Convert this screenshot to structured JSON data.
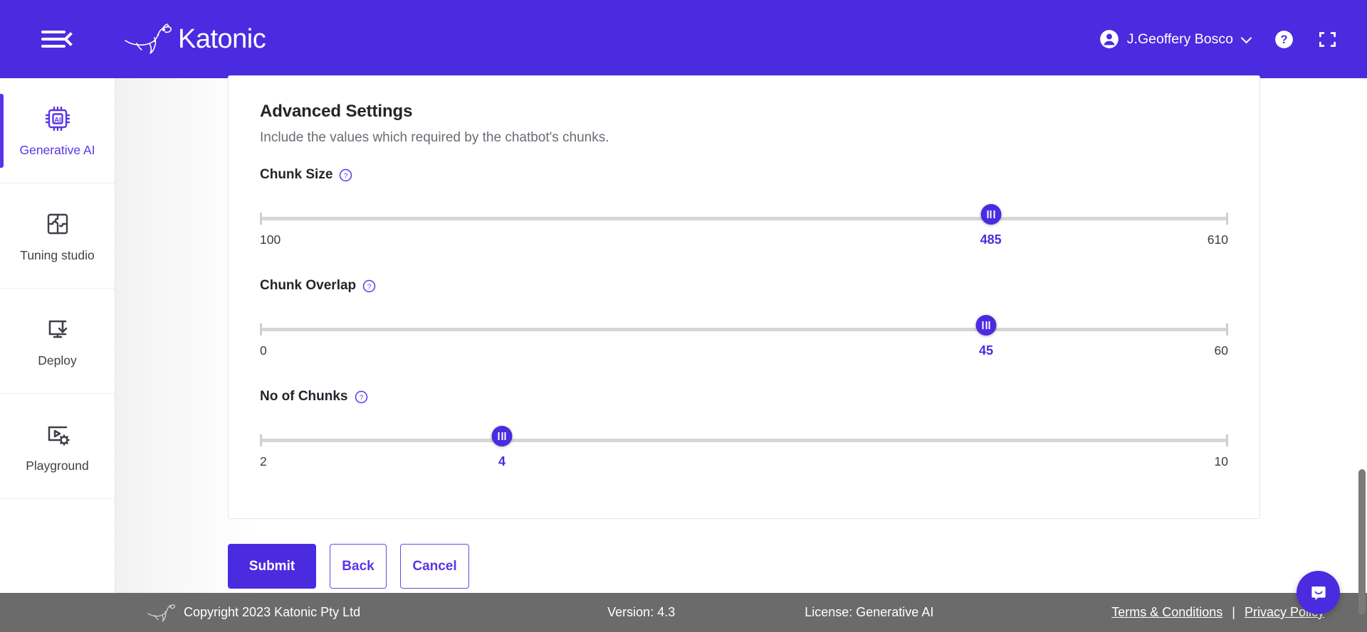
{
  "header": {
    "menu_toggle": "collapse-menu",
    "brand": "Katonic",
    "user_name": "J.Geoffery Bosco",
    "help_label": "?",
    "icons": {
      "avatar": "user-avatar-icon",
      "chevron": "chevron-down-icon",
      "help": "help-circle-icon",
      "fullscreen": "fullscreen-icon"
    },
    "colors": {
      "brand_purple": "#4B2BE0"
    }
  },
  "sidebar": {
    "items": [
      {
        "label": "Generative AI",
        "icon": "ai-chip-icon",
        "active": true
      },
      {
        "label": "Tuning studio",
        "icon": "puzzle-icon",
        "active": false
      },
      {
        "label": "Deploy",
        "icon": "monitor-download-icon",
        "active": false
      },
      {
        "label": "Playground",
        "icon": "video-gear-icon",
        "active": false
      }
    ]
  },
  "main": {
    "title": "Advanced Settings",
    "subtitle": "Include the values which required by the chatbot's chunks.",
    "sliders": [
      {
        "label": "Chunk Size",
        "min": "100",
        "max": "610",
        "value": "485",
        "min_num": 100,
        "max_num": 610,
        "value_num": 485
      },
      {
        "label": "Chunk Overlap",
        "min": "0",
        "max": "60",
        "value": "45",
        "min_num": 0,
        "max_num": 60,
        "value_num": 45
      },
      {
        "label": "No of Chunks",
        "label_alt": "No of Chunks",
        "min": "2",
        "max": "10",
        "value": "4",
        "min_num": 2,
        "max_num": 10,
        "value_num": 4
      }
    ],
    "help_icon_tooltip": "?"
  },
  "buttons": {
    "submit": "Submit",
    "back": "Back",
    "cancel": "Cancel"
  },
  "footer": {
    "copyright": "Copyright 2023 Katonic Pty Ltd",
    "version": "Version: 4.3",
    "license": "License: Generative AI",
    "terms": "Terms & Conditions",
    "separator": "|",
    "privacy": "Privacy Policy",
    "logo": "kangaroo-logo-icon"
  },
  "chat": {
    "icon": "chat-bubble-icon"
  }
}
